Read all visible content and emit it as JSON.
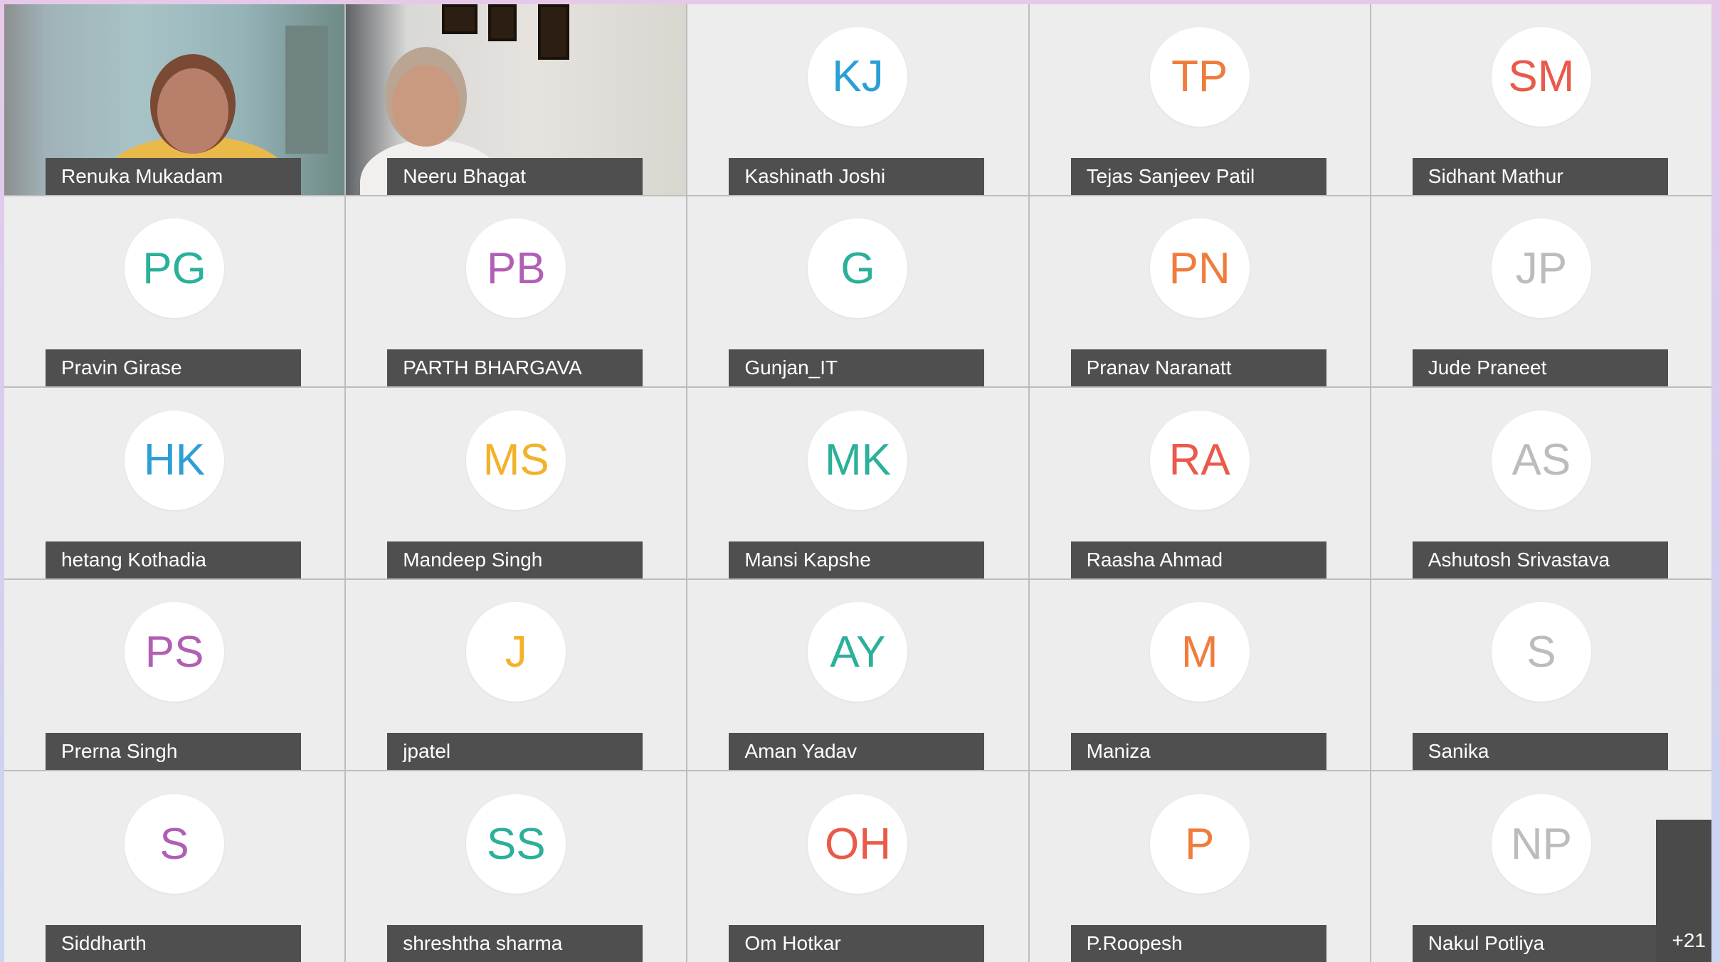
{
  "participants": [
    {
      "name": "Renuka Mukadam",
      "initials": "",
      "color": "",
      "video": true
    },
    {
      "name": "Neeru Bhagat",
      "initials": "",
      "color": "",
      "video": true
    },
    {
      "name": "Kashinath Joshi",
      "initials": "KJ",
      "color": "#2a9fd6",
      "video": false
    },
    {
      "name": "Tejas Sanjeev Patil",
      "initials": "TP",
      "color": "#f07c3c",
      "video": false
    },
    {
      "name": "Sidhant Mathur",
      "initials": "SM",
      "color": "#ea5a4a",
      "video": false
    },
    {
      "name": "Pravin Girase",
      "initials": "PG",
      "color": "#2bb09a",
      "video": false
    },
    {
      "name": "PARTH BHARGAVA",
      "initials": "PB",
      "color": "#b15fb4",
      "video": false
    },
    {
      "name": "Gunjan_IT",
      "initials": "G",
      "color": "#2bb09a",
      "video": false
    },
    {
      "name": "Pranav Naranatt",
      "initials": "PN",
      "color": "#f07c3c",
      "video": false
    },
    {
      "name": "Jude Praneet",
      "initials": "JP",
      "color": "#bcbcbc",
      "video": false
    },
    {
      "name": "hetang Kothadia",
      "initials": "HK",
      "color": "#2a9fd6",
      "video": false
    },
    {
      "name": "Mandeep Singh",
      "initials": "MS",
      "color": "#f2b22a",
      "video": false
    },
    {
      "name": "Mansi Kapshe",
      "initials": "MK",
      "color": "#2bb09a",
      "video": false
    },
    {
      "name": "Raasha Ahmad",
      "initials": "RA",
      "color": "#ea5a4a",
      "video": false
    },
    {
      "name": "Ashutosh Srivastava",
      "initials": "AS",
      "color": "#bcbcbc",
      "video": false
    },
    {
      "name": "Prerna Singh",
      "initials": "PS",
      "color": "#b15fb4",
      "video": false
    },
    {
      "name": "jpatel",
      "initials": "J",
      "color": "#f2b22a",
      "video": false
    },
    {
      "name": "Aman Yadav",
      "initials": "AY",
      "color": "#2bb09a",
      "video": false
    },
    {
      "name": "Maniza",
      "initials": "M",
      "color": "#f07c3c",
      "video": false
    },
    {
      "name": "Sanika",
      "initials": "S",
      "color": "#bcbcbc",
      "video": false
    },
    {
      "name": "Siddharth",
      "initials": "S",
      "color": "#b15fb4",
      "video": false
    },
    {
      "name": "shreshtha sharma",
      "initials": "SS",
      "color": "#2bb09a",
      "video": false
    },
    {
      "name": "Om Hotkar",
      "initials": "OH",
      "color": "#ea5a4a",
      "video": false
    },
    {
      "name": "P.Roopesh",
      "initials": "P",
      "color": "#f07c3c",
      "video": false
    },
    {
      "name": "Nakul Potliya",
      "initials": "NP",
      "color": "#bcbcbc",
      "video": false
    }
  ],
  "overflow": {
    "count_label": "+21"
  }
}
